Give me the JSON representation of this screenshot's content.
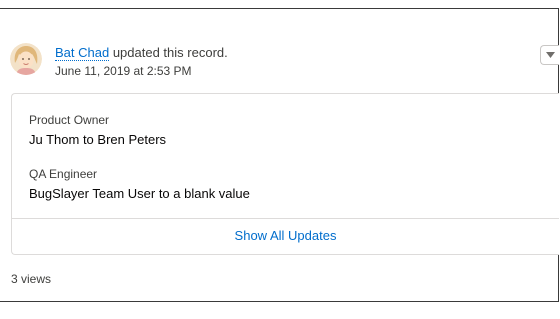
{
  "post": {
    "author": "Bat Chad",
    "action": "updated this record.",
    "timestamp": "June 11, 2019 at 2:53 PM",
    "avatar_icon": "user-avatar-icon",
    "menu_icon": "chevron-down-icon"
  },
  "changes": [
    {
      "field": "Product Owner",
      "value": "Ju Thom to Bren Peters"
    },
    {
      "field": "QA Engineer",
      "value": "BugSlayer Team User to a blank value"
    }
  ],
  "show_all_label": "Show All Updates",
  "views": "3 views",
  "colors": {
    "link": "#006dcc",
    "text": "#3e3e3c",
    "border": "#dddbda"
  }
}
